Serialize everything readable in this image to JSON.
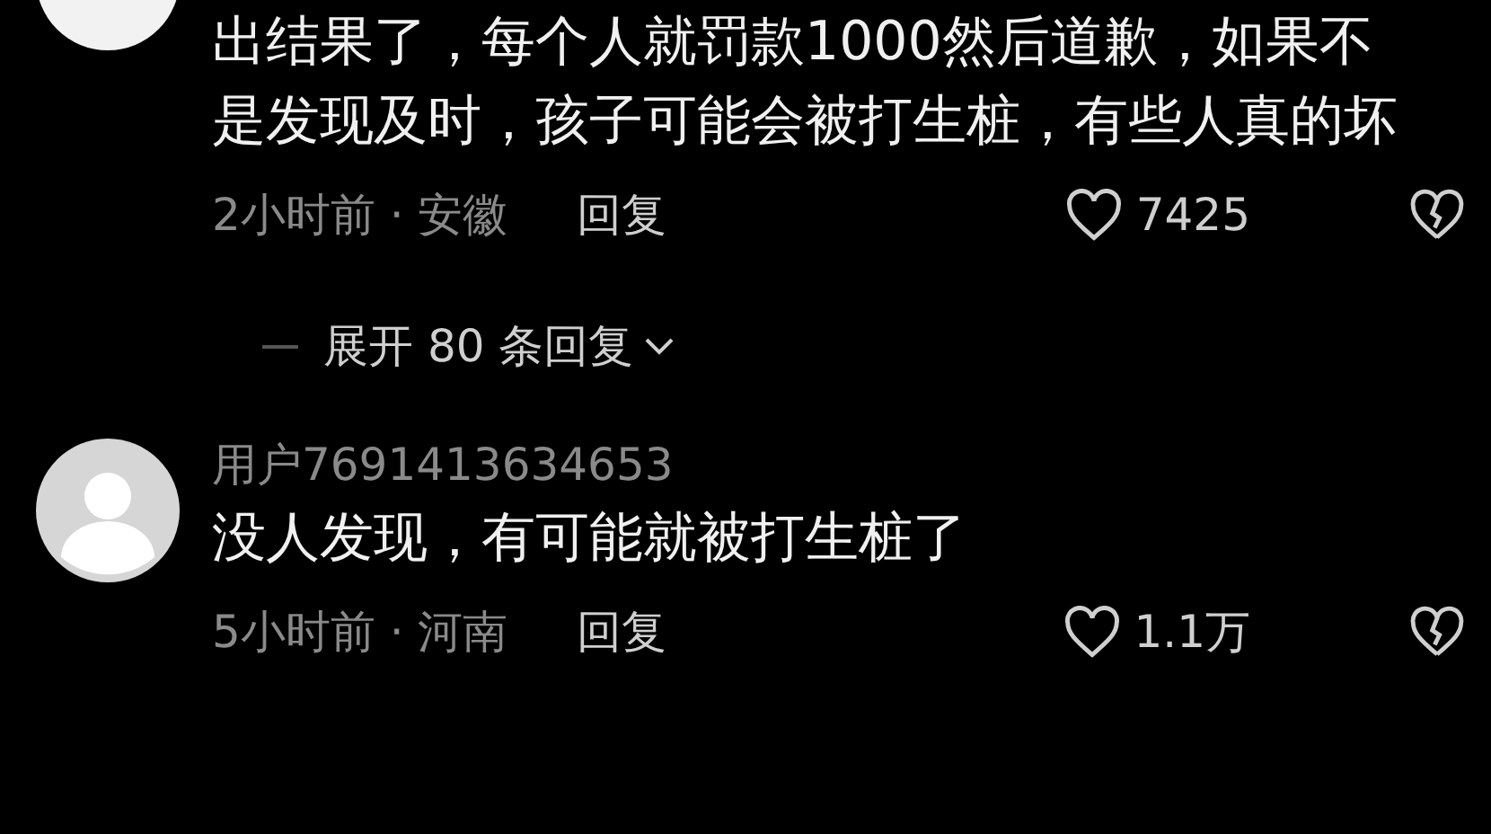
{
  "comments": [
    {
      "kind": "plain",
      "text": "出结果了，每个人就罚款1000然后道歉，如果不是发现及时，孩子可能会被打生桩，有些人真的坏",
      "meta": "2小时前 · 安徽",
      "reply": "回复",
      "likes": "7425",
      "expand": "展开 80 条回复"
    },
    {
      "kind": "silhouette",
      "username": "用户7691413634653",
      "text": "没人发现，有可能就被打生桩了",
      "meta": "5小时前 · 河南",
      "reply": "回复",
      "likes": "1.1万"
    }
  ]
}
